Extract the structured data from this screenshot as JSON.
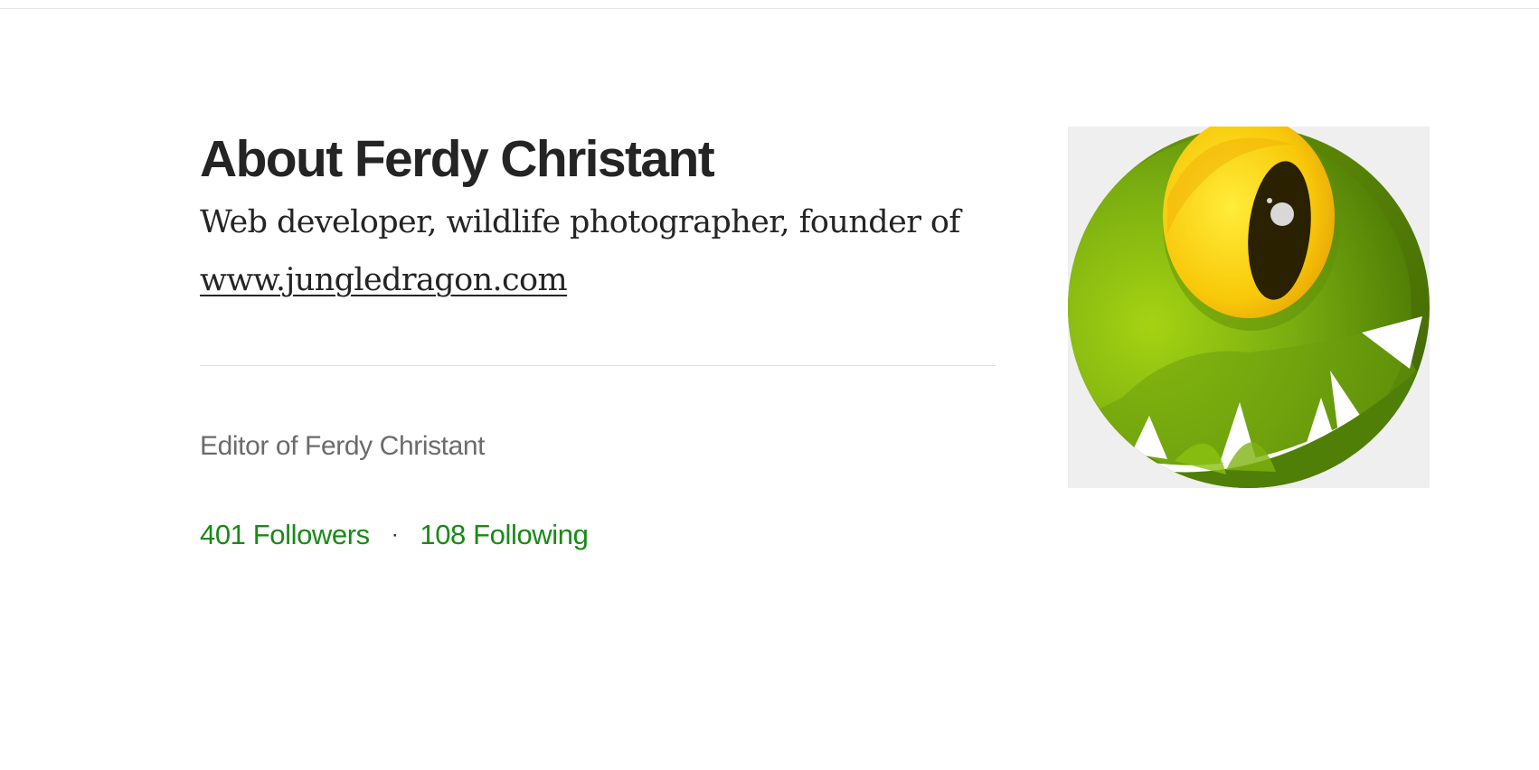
{
  "about": {
    "title": "About Ferdy Christant",
    "bio_text": "Web developer, wildlife photographer, founder of ",
    "bio_link": "www.jungledragon.com"
  },
  "editor": {
    "text": "Editor of Ferdy Christant"
  },
  "stats": {
    "followers": "401 Followers",
    "separator": "·",
    "following": "108 Following"
  },
  "avatar": {
    "icon": "green-dragon-eye-icon"
  },
  "colors": {
    "accent": "#1a8917",
    "text": "#242424",
    "muted": "#6b6b6b"
  }
}
